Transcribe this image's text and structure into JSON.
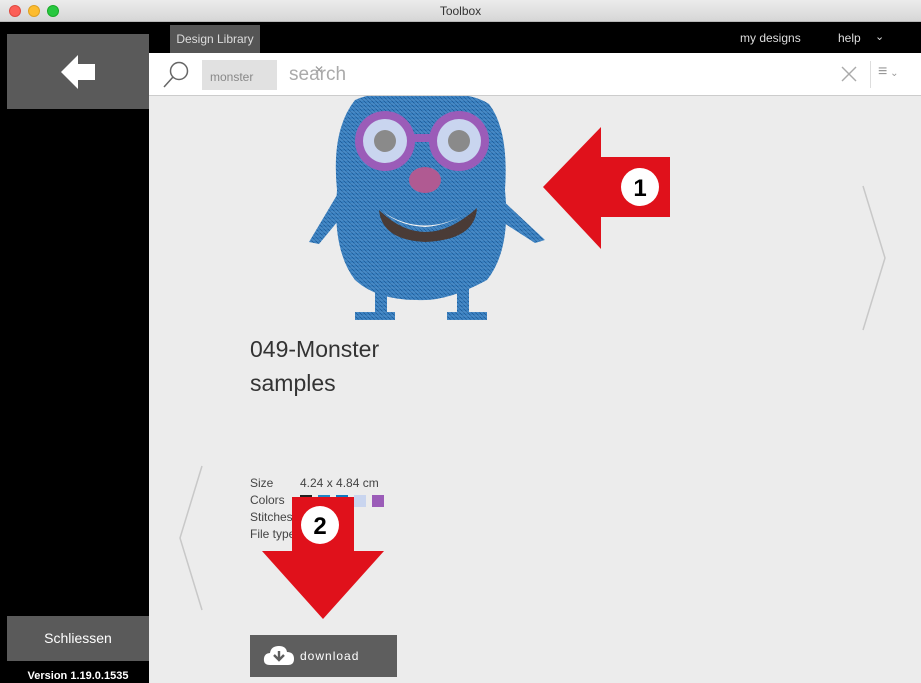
{
  "window": {
    "title": "Toolbox"
  },
  "sidebar": {
    "close_label": "Schliessen",
    "version": "Version 1.19.0.1535"
  },
  "topbar": {
    "tab_label": "Design Library",
    "my_designs_label": "my designs",
    "help_label": "help"
  },
  "search": {
    "filter_chip": "monster",
    "placeholder": "search",
    "value": ""
  },
  "design": {
    "title_line1": "049-Monster",
    "title_line2": "samples",
    "info": {
      "size_label": "Size",
      "size_value": "4.24 x 4.84 cm",
      "colors_label": "Colors",
      "stitches_label": "Stitches",
      "filetype_label": "File type"
    },
    "colors": [
      "#222222",
      "#1f86c6",
      "#0f78c0",
      "#c9d5ef",
      "#9b5cb8"
    ],
    "download_label": "download"
  },
  "annotations": {
    "callout_1": "1",
    "callout_2": "2",
    "arrow_color": "#e0111b"
  },
  "icons": {
    "back": "arrow-left-icon",
    "search": "magnifier-icon",
    "clear": "close-icon",
    "menu": "list-menu-icon",
    "download": "cloud-download-icon"
  }
}
